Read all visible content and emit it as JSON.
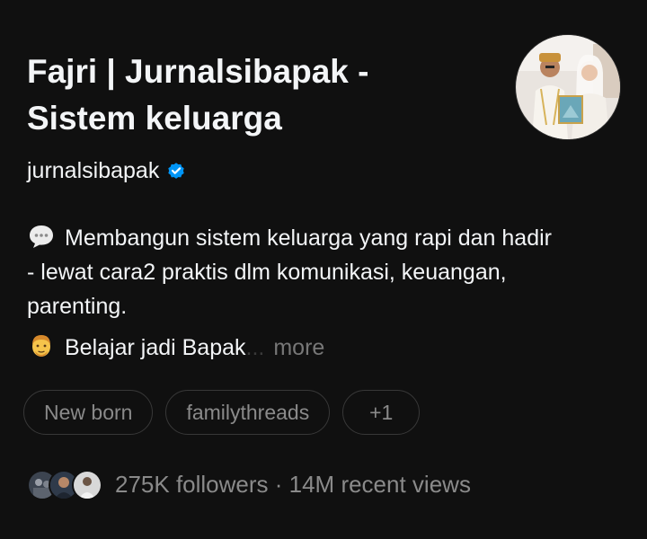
{
  "profile": {
    "name_line1": "Fajri | Jurnalsibapak -",
    "name_line2": "Sistem keluarga",
    "handle": "jurnalsibapak",
    "verified_icon": "verified-badge-icon",
    "avatar_icon": "profile-photo",
    "bio": {
      "emoji1": "speech-bubble-icon",
      "line1": "Membangun sistem keluarga yang rapi dan hadir",
      "line2": "- lewat cara2 praktis dlm komunikasi, keuangan,",
      "line3": "parenting.",
      "emoji2": "man-face-icon",
      "line4": "Belajar jadi Bapak",
      "more_dots": "...",
      "more_label": "more"
    },
    "chips": [
      {
        "label": "New born"
      },
      {
        "label": "familythreads"
      },
      {
        "label": "+1"
      }
    ],
    "followers_text": "275K followers · 14M recent views",
    "colors": {
      "background": "#101010",
      "primary_text": "#f3f5f7",
      "secondary_text": "#8a8a8a",
      "verified_blue": "#0095f6",
      "chip_border": "#383838"
    }
  }
}
